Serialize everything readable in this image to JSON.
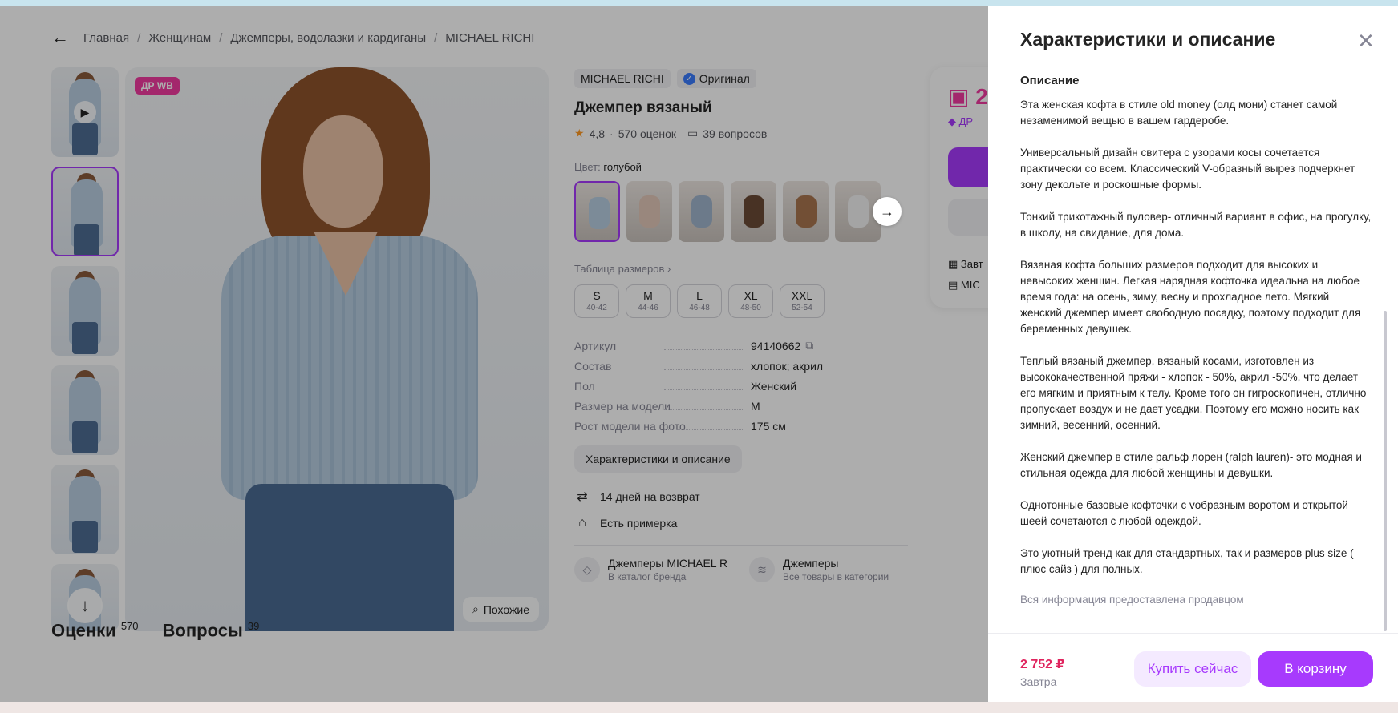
{
  "breadcrumbs": [
    "Главная",
    "Женщинам",
    "Джемперы, водолазки и кардиганы",
    "MICHAEL RICHI"
  ],
  "product": {
    "badge": "ДР WB",
    "brand": "MICHAEL RICHI",
    "original": "Оригинал",
    "title": "Джемпер вязаный",
    "rating": "4,8",
    "reviews_count": "570 оценок",
    "questions": "39 вопросов",
    "color_label": "Цвет:",
    "color_value": "голубой",
    "size_table": "Таблица размеров",
    "sizes": [
      {
        "label": "S",
        "range": "40-42"
      },
      {
        "label": "M",
        "range": "44-46"
      },
      {
        "label": "L",
        "range": "46-48"
      },
      {
        "label": "XL",
        "range": "48-50"
      },
      {
        "label": "XXL",
        "range": "52-54"
      }
    ],
    "specs": [
      {
        "k": "Артикул",
        "v": "94140662"
      },
      {
        "k": "Состав",
        "v": "хлопок; акрил"
      },
      {
        "k": "Пол",
        "v": "Женский"
      },
      {
        "k": "Размер на модели",
        "v": "M"
      },
      {
        "k": "Рост модели на фото",
        "v": "175 см"
      }
    ],
    "desc_button": "Характеристики и описание",
    "return_text": "14 дней на возврат",
    "fitting_text": "Есть примерка",
    "similar": "Похожие",
    "cat1_title": "Джемперы MICHAEL RICHI",
    "cat1_sub": "В каталог бренда",
    "cat2_title": "Джемперы",
    "cat2_sub": "Все товары в категории"
  },
  "pricecard": {
    "price_partial": "2",
    "badge_partial": "ДР",
    "deliv_partial": "Завт",
    "seller_partial": "MIC"
  },
  "tabs": {
    "reviews": "Оценки",
    "reviews_count": "570",
    "questions": "Вопросы",
    "questions_count": "39"
  },
  "drawer": {
    "title": "Характеристики и описание",
    "subtitle": "Описание",
    "paragraphs": [
      "Эта женская кофта в стиле old money (олд мони) станет самой незаменимой вещью в вашем гардеробе.",
      "Универсальный дизайн свитера с узорами косы сочетается практически со всем. Классический V-образный вырез подчеркнет зону декольте и роскошные формы.",
      "Тонкий трикотажный пуловер- отличный вариант в офис, на прогулку, в школу, на свидание, для дома.",
      "Вязаная кофта больших размеров подходит для высоких и невысоких женщин. Легкая нарядная кофточка идеальна на любое время года: на осень, зиму, весну и прохладное лето. Мягкий женский джемпер имеет свободную посадку, поэтому подходит для беременных девушек.",
      "Теплый вязаный джемпер, вязаный косами, изготовлен из высококачественной пряжи - хлопок - 50%, акрил -50%, что делает его мягким и приятным к телу. Кроме того он гигроскопичен, отлично пропускает воздух и не дает усадки. Поэтому его можно носить как зимний, весенний, осенний.",
      "Женский джемпер в стиле ральф лорен (ralph lauren)- это модная и стильная одежда для любой женщины и девушки.",
      "Однотонные базовые кофточки с vобразным воротом и открытой шеей сочетаются с любой одеждой.",
      "Это уютный тренд как для стандартных, так и размеров plus size ( плюс сайз ) для полных."
    ],
    "note": "Вся информация предоставлена продавцом",
    "price": "2 752 ₽",
    "delivery": "Завтра",
    "buy_now": "Купить сейчас",
    "to_cart": "В корзину"
  },
  "colors": {
    "accent": "#a73afd",
    "pink": "#f03aa0",
    "price": "#e0245e"
  }
}
